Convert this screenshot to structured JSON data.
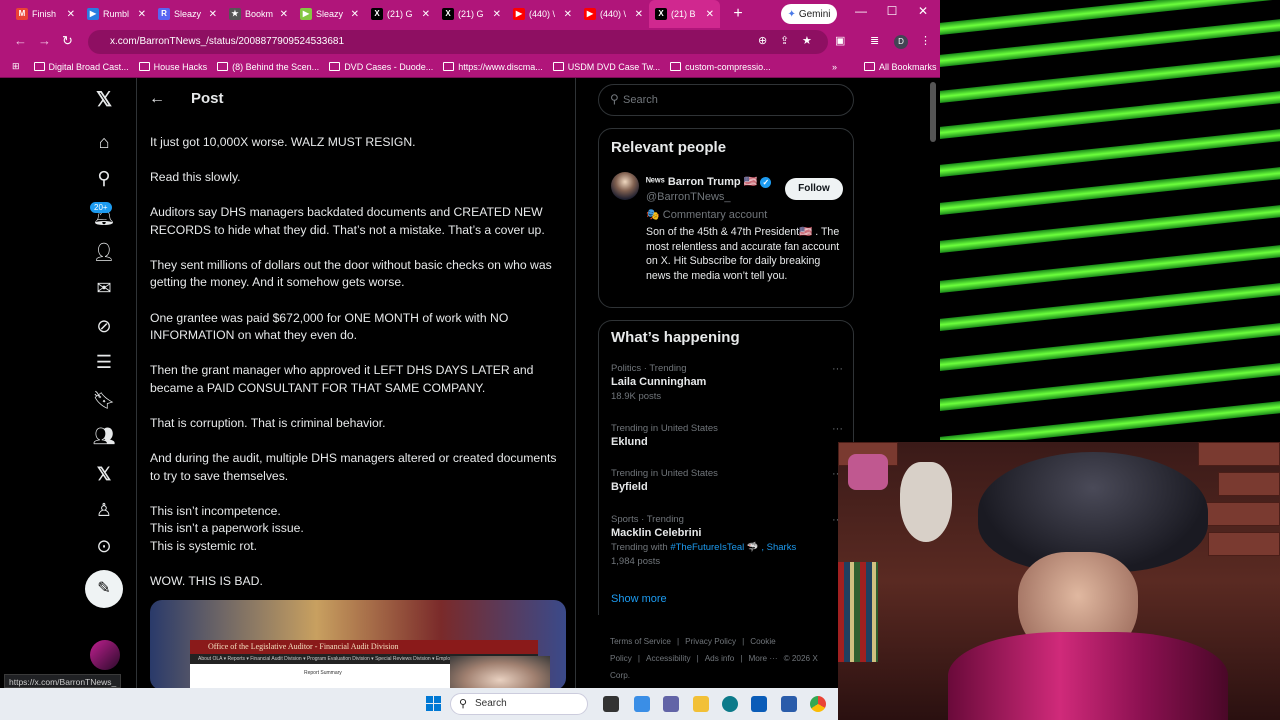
{
  "browser": {
    "tabs": [
      {
        "label": "Finish",
        "icon": "gmail-icon",
        "color": "#ea4335"
      },
      {
        "label": "Rumbl",
        "icon": "rumble-icon",
        "color": "#2a7de1"
      },
      {
        "label": "Sleazy",
        "icon": "r-icon",
        "color": "#5865f2"
      },
      {
        "label": "Bookm",
        "icon": "star-icon",
        "color": "#555"
      },
      {
        "label": "Sleazy",
        "icon": "rumble-play-icon",
        "color": "#85c742"
      },
      {
        "label": "(21) G",
        "icon": "x-icon",
        "color": "#000"
      },
      {
        "label": "(21) G",
        "icon": "x-icon",
        "color": "#000"
      },
      {
        "label": "(440) \\",
        "icon": "youtube-icon",
        "color": "#ff0000"
      },
      {
        "label": "(440) \\",
        "icon": "youtube-icon",
        "color": "#ff0000"
      },
      {
        "label": "(21) B",
        "icon": "x-icon",
        "color": "#000"
      }
    ],
    "gemini_label": "Gemini",
    "url": "x.com/BarronTNews_/status/2008877909524533681",
    "bookmarks": [
      "Digital Broad Cast...",
      "House Hacks",
      "(8) Behind the Scen...",
      "DVD Cases - Duode...",
      "https://www.discma...",
      "USDM DVD Case Tw...",
      "custom-compressio..."
    ],
    "all_bookmarks": "All Bookmarks",
    "status_url": "https://x.com/BarronTNews_",
    "accent": "#b0157a"
  },
  "nav": {
    "notif_badge": "20+"
  },
  "post": {
    "header": "Post",
    "paragraphs": [
      "It just got 10,000X worse. WALZ MUST RESIGN.",
      "Read this slowly.",
      "Auditors say DHS managers backdated documents and CREATED NEW RECORDS to hide what they did. That’s not a mistake. That’s a cover up.",
      "They sent millions of dollars out the door without basic checks on who was getting the money. And it somehow gets worse.",
      "One grantee was paid $672,000 for ONE MONTH of work with NO INFORMATION on what they even do.",
      "Then the grant manager who approved it LEFT DHS DAYS LATER and became a PAID CONSULTANT FOR THAT SAME COMPANY.",
      "That is corruption. That is criminal behavior.",
      "And during the audit, multiple DHS managers altered or created documents to try to save themselves."
    ],
    "triplet": [
      "This isn’t incompetence.",
      "This isn’t a paperwork issue.",
      "This is systemic rot."
    ],
    "closing": "WOW. THIS IS BAD.",
    "media_banner": "Office of the Legislative Auditor - Financial Audit Division",
    "media_nav": "About OLA ▾   Reports ▾   Financial Audit Division ▾   Program Evaluation Division ▾   Special Reviews Division ▾   Employment Opport...",
    "media_sub": "Report Summary"
  },
  "sidebar": {
    "search_placeholder": "Search",
    "relevant_title": "Relevant people",
    "person": {
      "name": "ᴺᵉʷˢ Barron Trump 🇺🇸",
      "handle": "@BarronTNews_",
      "commentary": "🎭 Commentary account",
      "bio": "Son of the 45th & 47th President🇺🇸 . The most relentless and accurate fan account on X. Hit Subscribe for daily breaking news the media won’t tell you.",
      "follow": "Follow"
    },
    "happening_title": "What’s happening",
    "trends": [
      {
        "context": "Politics · Trending",
        "name": "Laila Cunningham",
        "count": "18.9K posts"
      },
      {
        "context": "Trending in United States",
        "name": "Eklund",
        "count": ""
      },
      {
        "context": "Trending in United States",
        "name": "Byfield",
        "count": ""
      },
      {
        "context": "Sports · Trending",
        "name": "Macklin Celebrini",
        "with_prefix": "Trending with ",
        "with_tags": "#TheFutureIsTeal 🦈 , Sharks",
        "count": "1,984 posts"
      }
    ],
    "show_more": "Show more",
    "footer": [
      "Terms of Service",
      "|",
      "Privacy Policy",
      "|",
      "Cookie Policy",
      "|",
      "Accessibility",
      "|",
      "Ads info",
      "|",
      "More ···",
      "© 2026 X Corp."
    ]
  },
  "taskbar": {
    "search_label": "Search"
  }
}
